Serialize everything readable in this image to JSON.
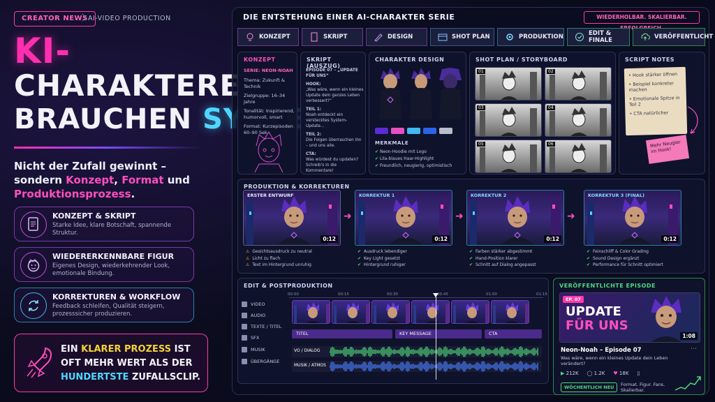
{
  "header": {
    "tag": "CREATOR NEWS",
    "tag_sub": "AI-VIDEO PRODUCTION",
    "title_line1": "KI-",
    "title_line2": "CHARAKTERE",
    "title_line3_a": "BRAUCHEN",
    "title_line3_b": "SYSTEM",
    "lead_a": "Nicht der Zufall gewinnt –",
    "lead_b": "sondern",
    "lead_konzept": "Konzept",
    "lead_comma": ",",
    "lead_format": "Format",
    "lead_und": "und",
    "lead_prod": "Produktionsprozess",
    "lead_dot": "."
  },
  "features": [
    {
      "title": "KONZEPT & SKRIPT",
      "desc": "Starke Idee, klare Botschaft, spannende Struktur.",
      "icon": "document-icon"
    },
    {
      "title": "WIEDERERKENNBARE FIGUR",
      "desc": "Eigenes Design, wiederkehrender Look, emotionale Bindung.",
      "icon": "face-icon"
    },
    {
      "title": "KORREKTUREN & WORKFLOW",
      "desc": "Feedback schleifen, Qualität steigern, prozesssicher produzieren.",
      "icon": "refresh-icon"
    }
  ],
  "quote": {
    "a": "EIN",
    "klarer": "KLARER PROZESS",
    "b": "IST OFT MEHR WERT ALS DER",
    "hundertste": "HUNDERTSTE",
    "c": "ZUFALLSCLIP."
  },
  "panel": {
    "title": "DIE ENTSTEHUNG EINER AI-CHARAKTER SERIE",
    "badge": "WIEDERHOLBAR. SKALIERBAR. ERFOLGREICH."
  },
  "steps": [
    "KONZEPT",
    "SKRIPT",
    "DESIGN",
    "SHOT PLAN",
    "PRODUKTION",
    "EDIT & FINALE",
    "VERÖFFENTLICHT"
  ],
  "konzept": {
    "heading": "KONZEPT",
    "series": "SERIE: NEON-NOAH",
    "items": [
      "Thema: Zukunft & Technik",
      "Zielgruppe: 16–34 Jahre",
      "Tonalität: Inspirierend, humorvoll, smart",
      "Format: Kurzepisoden 60–90 Sek."
    ]
  },
  "skript": {
    "heading": "SKRIPT (AUSZUG)",
    "episode": "EPISODE 07 – „UPDATE FÜR UNS“",
    "hook_label": "HOOK:",
    "hook": "„Was wäre, wenn ein kleines Update dein ganzes Leben verbessert?“",
    "teil1_label": "TEIL 1:",
    "teil1": "Noah entdeckt ein verstecktes System-Update…",
    "teil2_label": "TEIL 2:",
    "teil2": "Die Folgen überraschen ihn – und uns alle.",
    "cta_label": "CTA:",
    "cta": "Was würdest du updaten? Schreib's in die Kommentare!"
  },
  "design": {
    "heading": "CHARAKTER DESIGN",
    "merkmale_label": "MERKMALE",
    "merkmale": [
      "Neon-Hoodie mit Logo",
      "Lila-blaues Haar-Highlight",
      "Freundlich, neugierig, optimistisch"
    ],
    "swatches": [
      "#5a2bd6",
      "#e64fc4",
      "#3fb9f0",
      "#2c63e8",
      "#b9bccb"
    ]
  },
  "shotplan": {
    "heading": "SHOT PLAN / STORYBOARD",
    "frames": [
      "01",
      "02",
      "03",
      "04",
      "05",
      "06"
    ]
  },
  "notes": {
    "heading": "SCRIPT NOTES",
    "items": [
      "Hook stärker öffnen",
      "Beispiel konkreter machen",
      "Emotionale Spitze in Teil 2",
      "CTA natürlicher"
    ],
    "sticky": "Mehr Neugier im Hook!"
  },
  "produktion": {
    "heading": "PRODUKTION & KORREKTUREN",
    "stages": [
      {
        "label": "ERSTER ENTWURF",
        "dur": "0:12",
        "notes": [
          "Gesichtsausdruck zu neutral",
          "Licht zu flach",
          "Text im Hintergrund unruhig"
        ],
        "warn": true
      },
      {
        "label": "KORREKTUR 1",
        "dur": "0:12",
        "notes": [
          "Ausdruck lebendiger",
          "Key Light gesetzt",
          "Hintergrund ruhiger"
        ],
        "warn": false
      },
      {
        "label": "KORREKTUR 2",
        "dur": "0:12",
        "notes": [
          "Farben stärker abgestimmt",
          "Hand-Position klarer",
          "Schnitt auf Dialog angepasst"
        ],
        "warn": false
      },
      {
        "label": "KORREKTUR 3 (FINAL)",
        "dur": "0:12",
        "notes": [
          "Feinschliff & Color Grading",
          "Sound Design ergänzt",
          "Performance für Schnitt optimiert"
        ],
        "warn": false
      }
    ]
  },
  "edit": {
    "heading": "EDIT & POSTPRODUKTION",
    "tracks": [
      "VIDEO",
      "AUDIO",
      "TEXTE / TITEL",
      "SFX",
      "MUSIK",
      "ÜBERGÄNGE"
    ],
    "ticks": [
      "00:00",
      "00:15",
      "00:30",
      "00:45",
      "01:00",
      "01:15"
    ],
    "clip_titel": "TITEL",
    "clip_key": "KEY MESSAGE",
    "clip_cta": "CTA",
    "vo": "VO / DIALOG",
    "musik": "MUSIK / ATMOS"
  },
  "episode": {
    "heading": "VERÖFFENTLICHTE EPISODE",
    "ep": "EP. 07",
    "thumb_a": "UPDATE",
    "thumb_b": "FÜR UNS",
    "dur": "1:08",
    "title": "Neon-Noah – Episode 07",
    "desc": "Was wäre, wenn ein kleines Update dein Leben verändert?",
    "views": "212K",
    "comments": "1.2K",
    "likes": "18K",
    "weekly": "WÖCHENTLICH NEU",
    "tagline": "Format. Figur. Fans. Skalierbar."
  }
}
